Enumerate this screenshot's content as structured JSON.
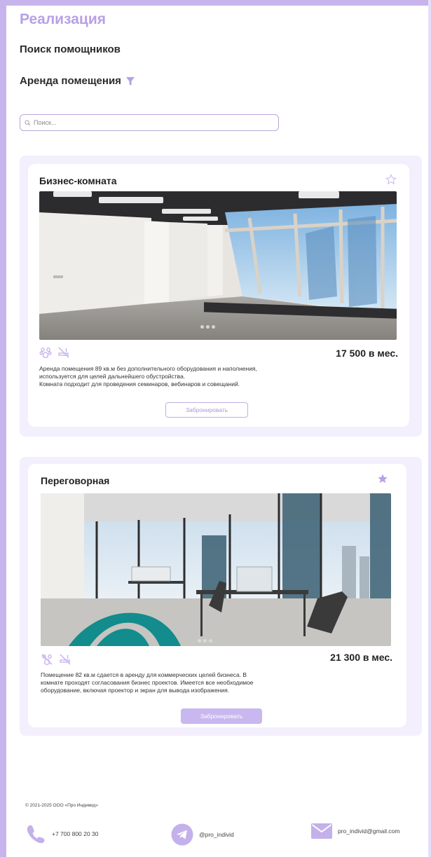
{
  "header": {
    "brand": "Реализация",
    "subtitle": "Поиск помощников",
    "section_title": "Аренда помещения"
  },
  "search": {
    "placeholder": "Поиск..."
  },
  "colors": {
    "accent": "#c7b4ec",
    "accent_text": "#b8a0e6",
    "card_bg": "#f3effd"
  },
  "listings": [
    {
      "title": "Бизнес-комната",
      "favorite": false,
      "price": "17 500 в мес.",
      "amenities": [
        "pet-icon",
        "no-smoking-icon"
      ],
      "description": "Аренда помещения 89 кв.м без дополнительного оборудования и наполнения,\nиспользуется для целей дальнейшего обустройства.\nКомната подходит для проведения семинаров, вебинаров и совещаний.",
      "book_label": "Забронировать"
    },
    {
      "title": "Переговорная",
      "favorite": true,
      "price": "21 300 в мес.",
      "amenities": [
        "no-pet-icon",
        "no-smoking-icon"
      ],
      "description": "Помещение 82 кв.м сдается в аренду для коммерческих целей бизнеса. В\nкомнате проходят согласования бизнес проектов. Имеется все необходимое\nоборудование, включая проектор и экран для вывода изображения.",
      "book_label": "Забронировать"
    }
  ],
  "footer": {
    "copyright": "© 2021-2025 ООО «Про Индивид»",
    "phone": "+7 700 800 20 30",
    "telegram": "@pro_individ",
    "email": "pro_individ@gmail.com"
  }
}
